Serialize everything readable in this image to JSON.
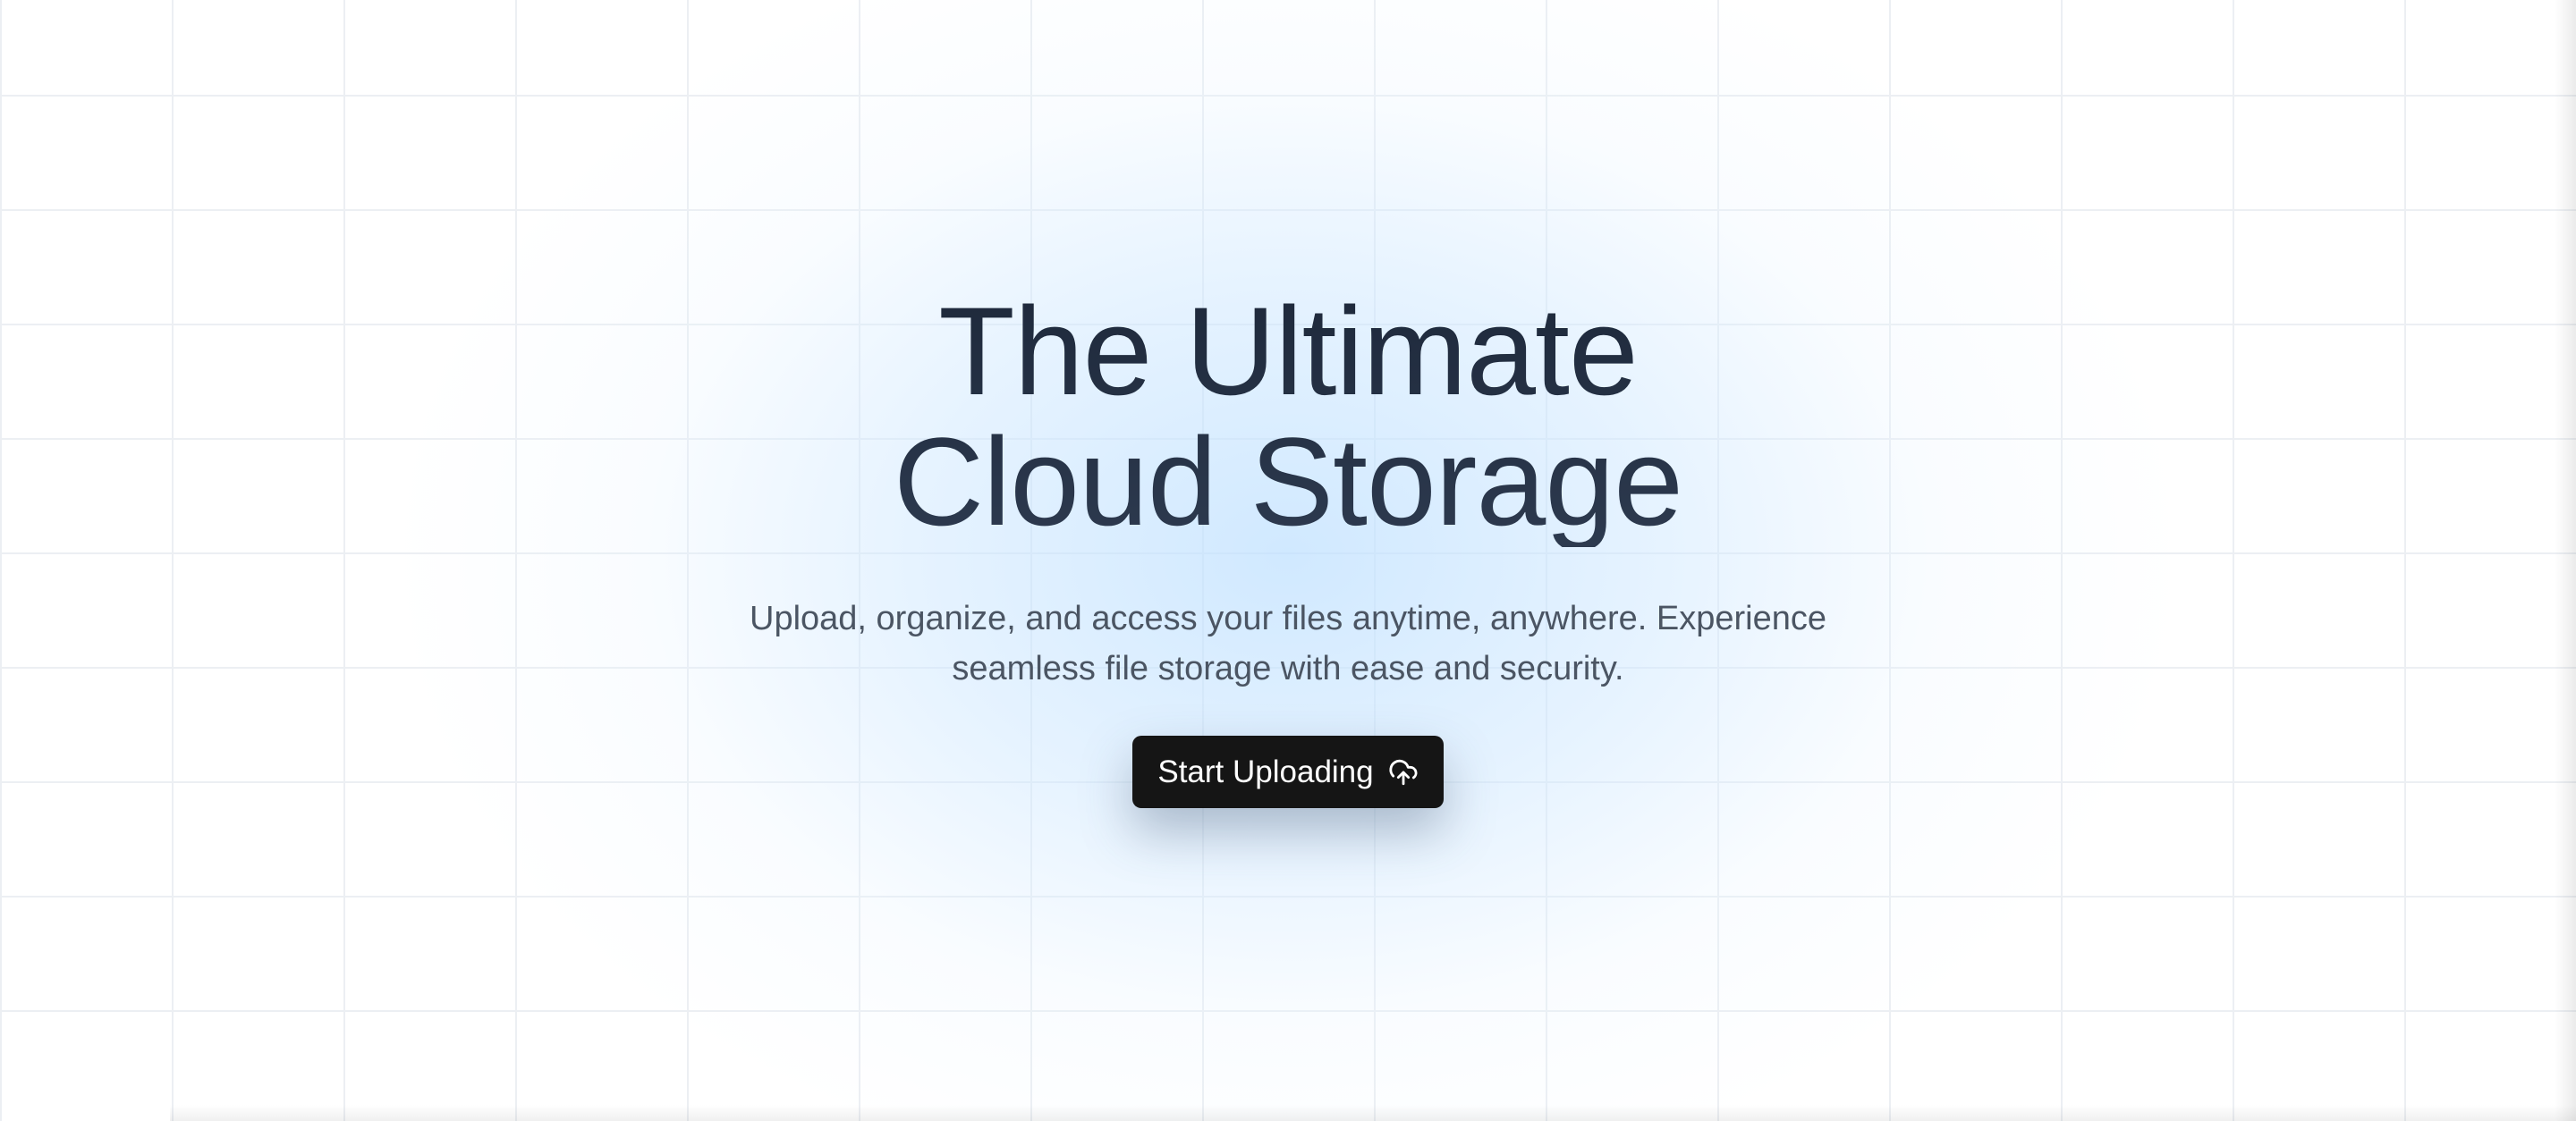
{
  "hero": {
    "title_line1": "The Ultimate",
    "title_line2": "Cloud Storage",
    "subtitle": "Upload, organize, and access your files anytime, anywhere. Experience seamless file storage with ease and security.",
    "cta_label": "Start Uploading",
    "cta_icon": "cloud-upload-icon"
  },
  "colors": {
    "title": "#1e293b",
    "subtitle": "#4b5563",
    "button_bg": "#151515",
    "button_text": "#ffffff",
    "glow": "#cfe6ff",
    "grid_line": "#eceff3"
  }
}
